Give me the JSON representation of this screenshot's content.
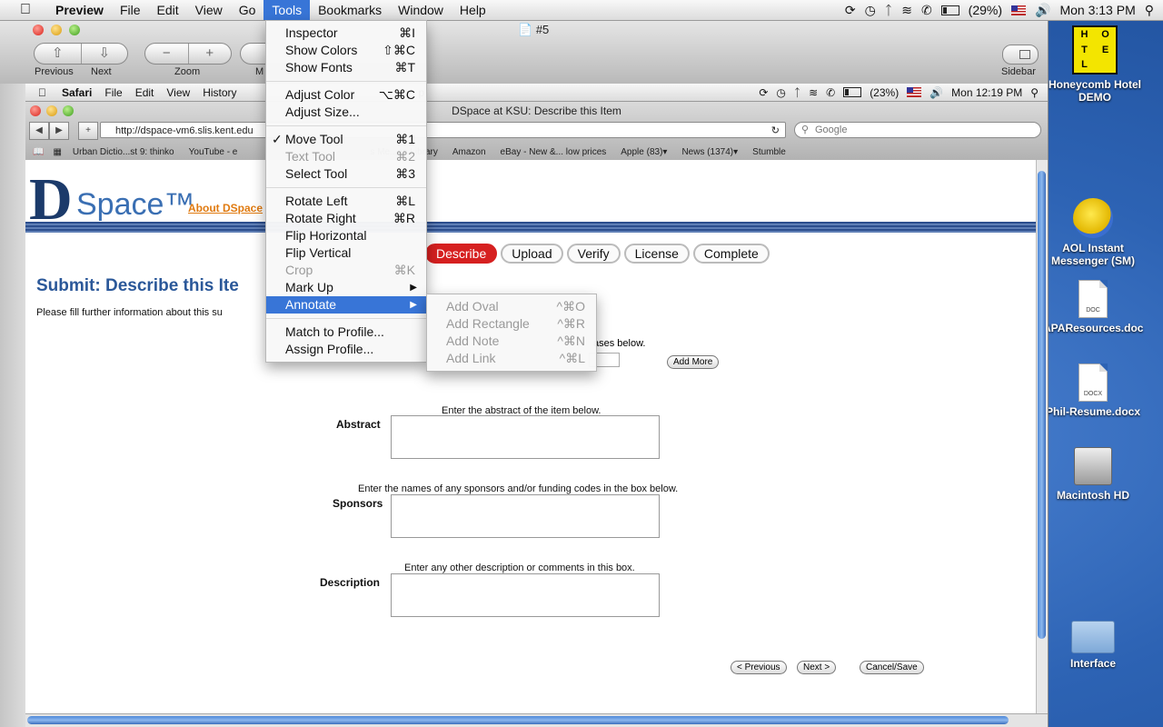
{
  "menubar": {
    "app": "Preview",
    "items": [
      "File",
      "Edit",
      "View",
      "Go",
      "Tools",
      "Bookmarks",
      "Window",
      "Help"
    ],
    "battery": "(29%)",
    "clock": "Mon 3:13 PM"
  },
  "preview_window": {
    "title": "#5",
    "toolbar": {
      "previous_label": "Previous",
      "next_label": "Next",
      "zoom_label": "Zoom",
      "sidebar_label": "Sidebar",
      "cropped_label": "M"
    }
  },
  "tools_menu": {
    "items": [
      {
        "label": "Inspector",
        "shortcut": "⌘I"
      },
      {
        "label": "Show Colors",
        "shortcut": "⇧⌘C"
      },
      {
        "label": "Show Fonts",
        "shortcut": "⌘T"
      },
      {
        "label": "Adjust Color",
        "shortcut": "⌥⌘C"
      },
      {
        "label": "Adjust Size...",
        "shortcut": ""
      },
      {
        "label": "Move Tool",
        "shortcut": "⌘1",
        "checked": true
      },
      {
        "label": "Text Tool",
        "shortcut": "⌘2",
        "disabled": true
      },
      {
        "label": "Select Tool",
        "shortcut": "⌘3"
      },
      {
        "label": "Rotate Left",
        "shortcut": "⌘L"
      },
      {
        "label": "Rotate Right",
        "shortcut": "⌘R"
      },
      {
        "label": "Flip Horizontal",
        "shortcut": ""
      },
      {
        "label": "Flip Vertical",
        "shortcut": ""
      },
      {
        "label": "Crop",
        "shortcut": "⌘K",
        "disabled": true
      },
      {
        "label": "Mark Up",
        "submenu": true
      },
      {
        "label": "Annotate",
        "submenu": true,
        "highlighted": true
      },
      {
        "label": "Match to Profile...",
        "shortcut": ""
      },
      {
        "label": "Assign Profile...",
        "shortcut": ""
      }
    ],
    "check_mark": "✓"
  },
  "annotate_menu": {
    "items": [
      {
        "label": "Add Oval",
        "shortcut": "^⌘O"
      },
      {
        "label": "Add Rectangle",
        "shortcut": "^⌘R"
      },
      {
        "label": "Add Note",
        "shortcut": "^⌘N"
      },
      {
        "label": "Add Link",
        "shortcut": "^⌘L"
      }
    ]
  },
  "inner_screenshot": {
    "menubar": {
      "app": "Safari",
      "items": [
        "File",
        "Edit",
        "View",
        "History"
      ],
      "trailing": "p",
      "battery": "(23%)",
      "clock": "Mon 12:19 PM"
    },
    "safari": {
      "title": "DSpace at KSU: Describe this Item",
      "url": "http://dspace-vm6.slis.kent.edu",
      "search_placeholder": "Google",
      "bookmarks": [
        "Urban Dictio...st 9: thinko",
        "YouTube - e",
        "s Me...an Library",
        "Amazon",
        "eBay - New &... low prices",
        "Apple (83)▾",
        "News (1374)▾",
        "Stumble"
      ]
    },
    "page": {
      "logo_d": "D",
      "logo_space": "Space™",
      "about_link": "About DSpace",
      "steps": [
        "Describe",
        "Upload",
        "Verify",
        "License",
        "Complete"
      ],
      "current_step": "Describe",
      "heading": "Submit: Describe this Ite",
      "intro": "Please fill further information about this su",
      "fragment_text": "ases below.",
      "add_more": "Add More",
      "fields": [
        {
          "hint": "Enter the abstract of the item below.",
          "label": "Abstract"
        },
        {
          "hint": "Enter the names of any sponsors and/or funding codes in the box below.",
          "label": "Sponsors"
        },
        {
          "hint": "Enter any other description or comments in this box.",
          "label": "Description"
        }
      ],
      "buttons": {
        "previous": "< Previous",
        "next": "Next >",
        "cancel": "Cancel/Save"
      }
    }
  },
  "desktop_icons": [
    {
      "label": "Honeycomb Hotel DEMO",
      "icon": "hotel-icon",
      "glyph": [
        "H",
        "O",
        "T",
        "E",
        "L"
      ]
    },
    {
      "label": "AOL Instant Messenger (SM)",
      "icon": "aim-icon"
    },
    {
      "label": "APAResources.doc",
      "icon": "doc-icon",
      "badge": "DOC"
    },
    {
      "label": "Phil-Resume.docx",
      "icon": "docx-icon",
      "badge": "DOCX"
    },
    {
      "label": "Macintosh HD",
      "icon": "hard-drive-icon"
    },
    {
      "label": "Interface",
      "icon": "folder-icon"
    }
  ]
}
